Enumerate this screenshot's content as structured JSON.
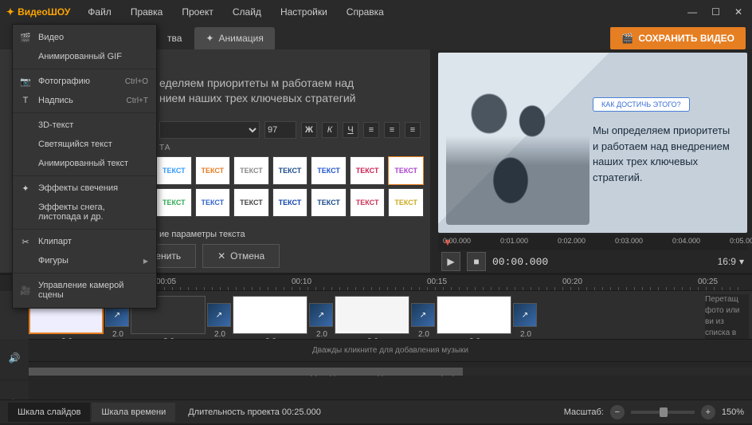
{
  "app": {
    "name": "ВидеоШОУ"
  },
  "menu": {
    "items": [
      "Файл",
      "Правка",
      "Проект",
      "Слайд",
      "Настройки",
      "Справка"
    ]
  },
  "toolbar": {
    "save": "СОХРАНИТЬ ВИДЕО"
  },
  "tabs": {
    "properties": "тва",
    "animation": "Анимация"
  },
  "dropdown": {
    "items": [
      {
        "icon": "🎬",
        "label": "Видео",
        "shortcut": ""
      },
      {
        "icon": "",
        "label": "Анимированный GIF",
        "shortcut": ""
      },
      {
        "sep": true
      },
      {
        "icon": "📷",
        "label": "Фотографию",
        "shortcut": "Ctrl+O"
      },
      {
        "icon": "T",
        "label": "Надпись",
        "shortcut": "Ctrl+T"
      },
      {
        "sep": true
      },
      {
        "icon": "",
        "label": "3D-текст",
        "shortcut": ""
      },
      {
        "icon": "",
        "label": "Светящийся текст",
        "shortcut": ""
      },
      {
        "icon": "",
        "label": "Анимированный текст",
        "shortcut": ""
      },
      {
        "sep": true
      },
      {
        "icon": "✦",
        "label": "Эффекты свечения",
        "shortcut": ""
      },
      {
        "icon": "",
        "label": "Эффекты снега, листопада и др.",
        "shortcut": ""
      },
      {
        "sep": true
      },
      {
        "icon": "✂",
        "label": "Клипарт",
        "shortcut": ""
      },
      {
        "icon": "",
        "label": "Фигуры",
        "arrow": true
      },
      {
        "sep": true
      },
      {
        "icon": "🎥",
        "label": "Управление камерой сцены",
        "shortcut": ""
      }
    ]
  },
  "edit": {
    "title_l1": "еделяем приоритеты м работаем над",
    "title_l2": "нием наших трех ключевых стратегий",
    "size": "97",
    "section": "ТА",
    "style_label": "ТЕКСТ",
    "more_params": "ие параметры текста",
    "apply": "Применить",
    "cancel": "Отмена"
  },
  "preview": {
    "badge": "КАК ДОСТИЧЬ ЭТОГО?",
    "text": "Мы определяем приоритеты и работаем над внедрением наших трех ключевых стратегий.",
    "ruler": [
      "0:00.000",
      "0:01.000",
      "0:02.000",
      "0:03.000",
      "0:04.000",
      "0:05.000"
    ],
    "time": "00:00.000",
    "aspect": "16:9"
  },
  "timeline": {
    "ticks": [
      "00:05",
      "00:10",
      "00:15",
      "00:20",
      "00:25"
    ],
    "slide_dur": "2.0",
    "hint_music": "Дважды кликните для добавления музыки",
    "hint_mic": "Дважды кликните для записи с микрофона",
    "drag_hint": "Перетащ фото или ви из списка в"
  },
  "status": {
    "tab_slides": "Шкала слайдов",
    "tab_time": "Шкала времени",
    "duration": "Длительность проекта 00:25.000",
    "zoom_label": "Масштаб:",
    "zoom_value": "150%"
  },
  "style_colors": [
    "#3399ff",
    "#e67e22",
    "#888888",
    "#1a4a8a",
    "#2255cc",
    "#cc2255",
    "#aa44cc",
    "#33aa55",
    "#3366cc",
    "#444444",
    "#1144aa",
    "#1a4a8a",
    "#cc3355",
    "#ccaa22"
  ]
}
